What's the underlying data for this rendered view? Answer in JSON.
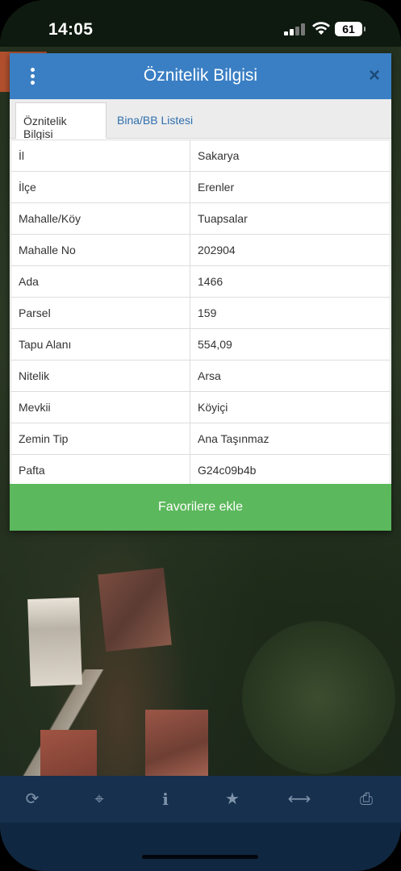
{
  "status_bar": {
    "time": "14:05",
    "battery": "61"
  },
  "modal": {
    "title": "Öznitelik Bilgisi",
    "close_glyph": "×",
    "tabs": [
      {
        "label": "Öznitelik Bilgisi",
        "active": true
      },
      {
        "label": "Bina/BB Listesi",
        "active": false
      }
    ],
    "rows": [
      {
        "key": "İl",
        "value": "Sakarya"
      },
      {
        "key": "İlçe",
        "value": "Erenler"
      },
      {
        "key": "Mahalle/Köy",
        "value": "Tuapsalar"
      },
      {
        "key": "Mahalle No",
        "value": "202904"
      },
      {
        "key": "Ada",
        "value": "1466"
      },
      {
        "key": "Parsel",
        "value": "159"
      },
      {
        "key": "Tapu Alanı",
        "value": "554,09"
      },
      {
        "key": "Nitelik",
        "value": "Arsa"
      },
      {
        "key": "Mevkii",
        "value": "Köyiçi"
      },
      {
        "key": "Zemin Tip",
        "value": "Ana Taşınmaz"
      },
      {
        "key": "Pafta",
        "value": "G24c09b4b"
      }
    ],
    "favorite_button": "Favorilere ekle"
  },
  "toolbar": {
    "icons": [
      {
        "name": "refresh-icon",
        "glyph": "⟳"
      },
      {
        "name": "locate-icon",
        "glyph": "⌖"
      },
      {
        "name": "info-icon",
        "glyph": "i"
      },
      {
        "name": "star-icon",
        "glyph": "★"
      },
      {
        "name": "measure-icon",
        "glyph": "⟷"
      },
      {
        "name": "print-icon",
        "glyph": "⎙"
      }
    ]
  },
  "colors": {
    "header_blue": "#3a7fc4",
    "button_green": "#5cb85c",
    "toolbar_navy": "#16304e",
    "tab_link_blue": "#2f6fae"
  }
}
